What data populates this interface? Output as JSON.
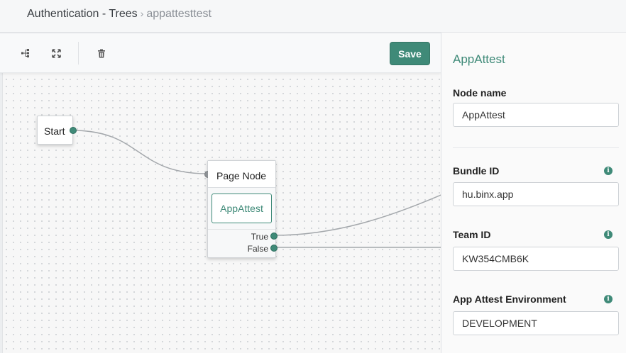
{
  "breadcrumb": {
    "parent": "Authentication - Trees",
    "separator": "›",
    "current": "appattesttest"
  },
  "toolbar": {
    "save_label": "Save",
    "icons": [
      "tree-layout-icon",
      "fit-to-screen-icon",
      "trash-icon"
    ]
  },
  "canvas": {
    "start_node": {
      "label": "Start"
    },
    "page_node": {
      "title": "Page Node",
      "child": "AppAttest",
      "outcomes": [
        "True",
        "False"
      ]
    }
  },
  "panel": {
    "title": "AppAttest",
    "fields": [
      {
        "label": "Node name",
        "value": "AppAttest",
        "info": false
      },
      {
        "label": "Bundle ID",
        "value": "hu.binx.app",
        "info": true
      },
      {
        "label": "Team ID",
        "value": "KW354CMB6K",
        "info": true
      },
      {
        "label": "App Attest Environment",
        "value": "DEVELOPMENT",
        "info": true
      }
    ]
  },
  "colors": {
    "accent": "#3f8a78",
    "port_in": "#8e9296",
    "wire": "#a4a8ac"
  }
}
